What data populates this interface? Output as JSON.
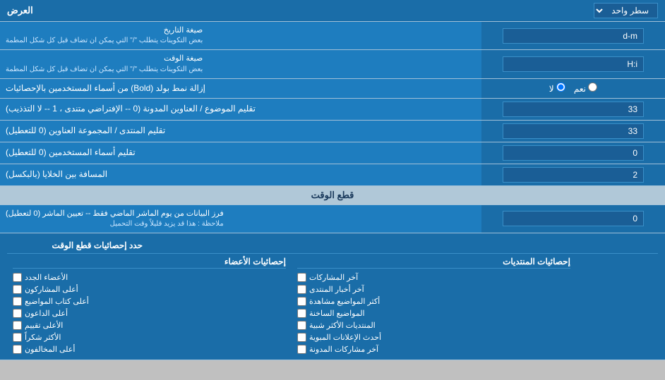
{
  "header": {
    "label": "العرض",
    "dropdown_label": "سطر واحد",
    "dropdown_icon": "▼"
  },
  "rows": [
    {
      "id": "date_format",
      "label": "صيغة التاريخ",
      "sublabel": "بعض التكوينات يتطلب \"/\" التي يمكن ان تضاف قبل كل شكل المطمة",
      "value": "d-m"
    },
    {
      "id": "time_format",
      "label": "صيغة الوقت",
      "sublabel": "بعض التكوينات يتطلب \"/\" التي يمكن ان تضاف قبل كل شكل المطمة",
      "value": "H:i"
    },
    {
      "id": "bold_remove",
      "label": "إزالة نمط بولد (Bold) من أسماء المستخدمين بالإحصائيات",
      "type": "radio",
      "options": [
        {
          "label": "نعم",
          "value": "yes"
        },
        {
          "label": "لا",
          "value": "no",
          "checked": true
        }
      ]
    },
    {
      "id": "subject_titles",
      "label": "تقليم الموضوع / العناوين المدونة (0 -- الإفتراضي متندى ، 1 -- لا التذذيب)",
      "value": "33"
    },
    {
      "id": "forum_titles",
      "label": "تقليم المنتدى / المجموعة العناوين (0 للتعطيل)",
      "value": "33"
    },
    {
      "id": "usernames_trim",
      "label": "تقليم أسماء المستخدمين (0 للتعطيل)",
      "value": "0"
    },
    {
      "id": "space_between",
      "label": "المسافة بين الخلايا (بالبكسل)",
      "value": "2"
    }
  ],
  "cut_time_section": {
    "header": "قطع الوقت",
    "row": {
      "id": "cut_time_value",
      "label": "فرز البيانات من يوم الماشر الماضي فقط -- تعيين الماشر (0 لتعطيل)",
      "note": "ملاحظة : هذا قد يزيد قليلاً وقت التحميل",
      "value": "0"
    }
  },
  "stats_section": {
    "header": "حدد إحصائيات قطع الوقت",
    "col1_header": "",
    "col2_header": "إحصائيات المنتديات",
    "col3_header": "إحصائيات الأعضاء",
    "col2_items": [
      {
        "label": "آخر المشاركات",
        "checked": false
      },
      {
        "label": "آخر أخبار المنتدى",
        "checked": false
      },
      {
        "label": "أكثر المواضيع مشاهدة",
        "checked": false
      },
      {
        "label": "المواضيع الساخنة",
        "checked": false
      },
      {
        "label": "المنتديات الأكثر شبية",
        "checked": false
      },
      {
        "label": "أحدث الإعلانات المبوية",
        "checked": false
      },
      {
        "label": "آخر مشاركات المدونة",
        "checked": false
      }
    ],
    "col3_items": [
      {
        "label": "الأعضاء الجدد",
        "checked": false
      },
      {
        "label": "أعلى المشاركون",
        "checked": false
      },
      {
        "label": "أعلى كتاب المواضيع",
        "checked": false
      },
      {
        "label": "أعلى الداعون",
        "checked": false
      },
      {
        "label": "الأعلى تقييم",
        "checked": false
      },
      {
        "label": "الأكثر شكراً",
        "checked": false
      },
      {
        "label": "أعلى المخالفون",
        "checked": false
      }
    ]
  },
  "colors": {
    "bg_blue": "#1a6da8",
    "bg_light_blue": "#b0c8d8",
    "border_blue": "#3a8fc8",
    "text_white": "#ffffff",
    "text_dark": "#1a3a5c"
  }
}
